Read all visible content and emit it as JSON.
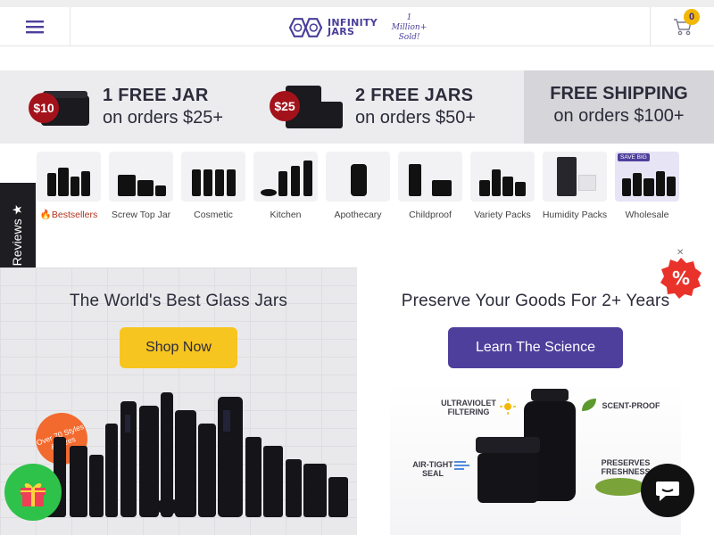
{
  "header": {
    "logo_line1": "INFINITY",
    "logo_line2": "JARS",
    "logo_tagline_1": "1 Million+",
    "logo_tagline_2": "Sold!",
    "cart_count": "0"
  },
  "promos": [
    {
      "tag": "$10",
      "title": "1 FREE JAR",
      "subtitle": "on orders $25+"
    },
    {
      "tag": "$25",
      "title": "2 FREE JARS",
      "subtitle": "on orders $50+"
    },
    {
      "title": "FREE SHIPPING",
      "subtitle": "on orders $100+"
    }
  ],
  "categories": [
    {
      "label": "Bestsellers",
      "prefix": "🔥"
    },
    {
      "label": "Screw Top Jar"
    },
    {
      "label": "Cosmetic"
    },
    {
      "label": "Kitchen"
    },
    {
      "label": "Apothecary"
    },
    {
      "label": "Childproof"
    },
    {
      "label": "Variety Packs"
    },
    {
      "label": "Humidity Packs"
    },
    {
      "label": "Wholesale",
      "badge": "SAVE BIG"
    }
  ],
  "reviews_tab": "★ Real Customer Reviews ★",
  "hero_left": {
    "title": "The World's Best Glass Jars",
    "button": "Shop Now",
    "badge": "Over 70 Styles & Sizes"
  },
  "hero_right": {
    "title": "Preserve Your Goods For 2+ Years",
    "button": "Learn The Science",
    "features": {
      "uv": "ULTRAVIOLET FILTERING",
      "scent": "SCENT-PROOF",
      "air": "AIR-TIGHT SEAL",
      "fresh": "PRESERVES FRESHNESS"
    }
  },
  "discount_label": "%",
  "colors": {
    "brand_purple": "#4e3f9c",
    "button_yellow": "#f7c520",
    "tag_red": "#a3121a",
    "gift_green": "#2ec24a",
    "discount_red": "#e8322a"
  }
}
